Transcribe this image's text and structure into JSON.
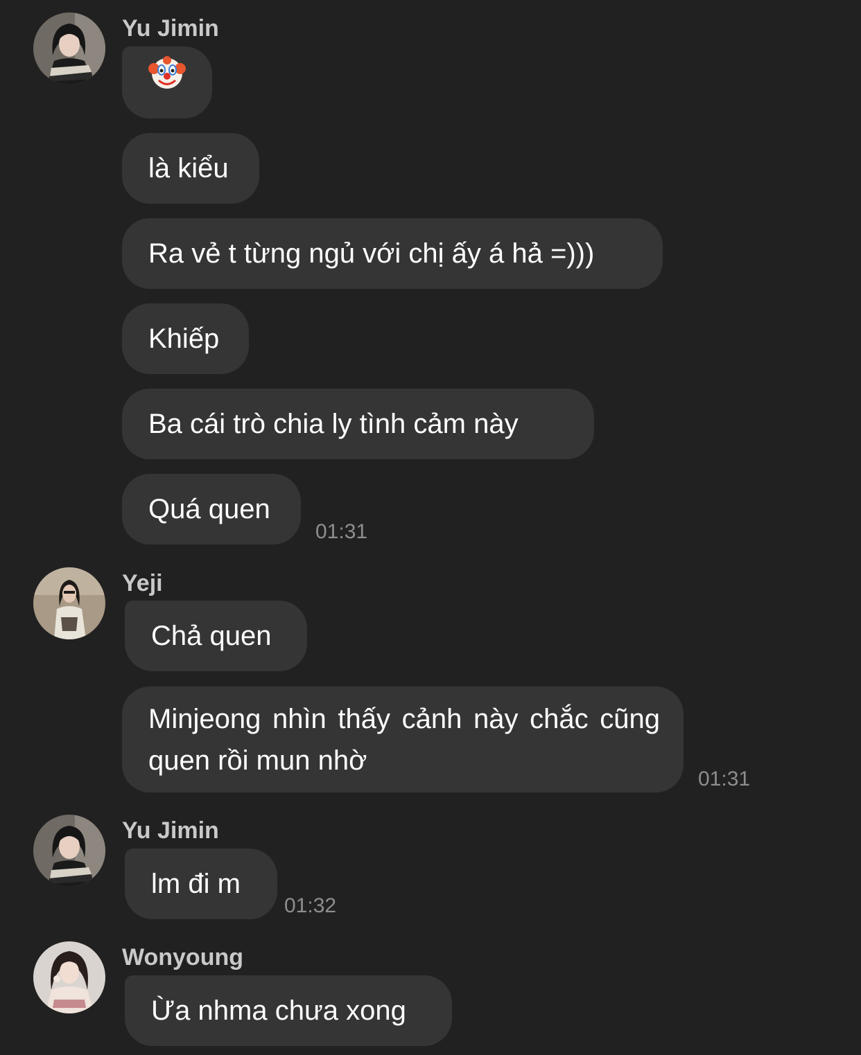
{
  "messages": [
    {
      "sender": "Yu Jimin",
      "avatar_icon": "avatar-yu-jimin",
      "bubbles": [
        {
          "text": "",
          "emoji": "clown-face-icon"
        },
        {
          "text": "là kiểu"
        },
        {
          "text": "Ra vẻ t từng ngủ với chị ấy á hả =)))"
        },
        {
          "text": "Khiếp"
        },
        {
          "text": "Ba cái trò chia ly tình cảm này"
        },
        {
          "text": "Quá quen"
        }
      ],
      "time": "01:31"
    },
    {
      "sender": "Yeji",
      "avatar_icon": "avatar-yeji",
      "bubbles": [
        {
          "text": "Chả quen"
        },
        {
          "text": "Minjeong nhìn thấy cảnh này chắc cũng quen rồi mun nhờ"
        }
      ],
      "time": "01:31"
    },
    {
      "sender": "Yu Jimin",
      "avatar_icon": "avatar-yu-jimin",
      "bubbles": [
        {
          "text": "lm đi m"
        }
      ],
      "time": "01:32"
    },
    {
      "sender": "Wonyoung",
      "avatar_icon": "avatar-wonyoung",
      "bubbles": [
        {
          "text": "Ừa nhma chưa xong"
        }
      ]
    }
  ],
  "colors": {
    "background": "#212121",
    "bubble": "#353535",
    "sender": "#c9c9c9",
    "timestamp": "#8e8e8e"
  }
}
